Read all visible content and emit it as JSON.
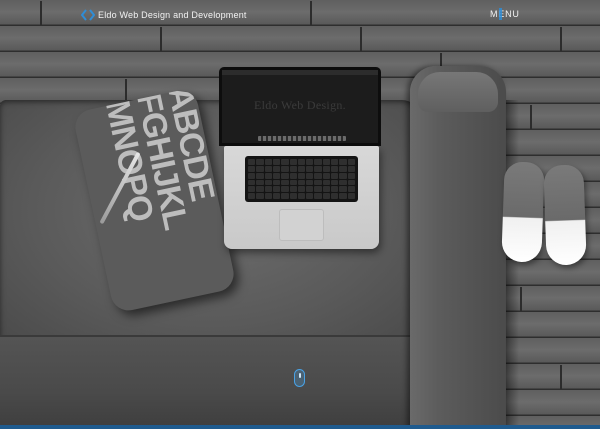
{
  "header": {
    "brand_name": "Eldo Web Design and Development",
    "menu_label": "MENU"
  },
  "hero": {
    "laptop_screen_title": "Eldo Web Design.",
    "pillow_lines": [
      "ABCDE",
      "FGHIJKL",
      "MNOPQ"
    ]
  },
  "colors": {
    "accent": "#2f8dd6",
    "bottom_bar": "#1f5b8e"
  },
  "icons": {
    "brand": "code-brackets-icon",
    "scroll": "mouse-scroll-icon"
  }
}
